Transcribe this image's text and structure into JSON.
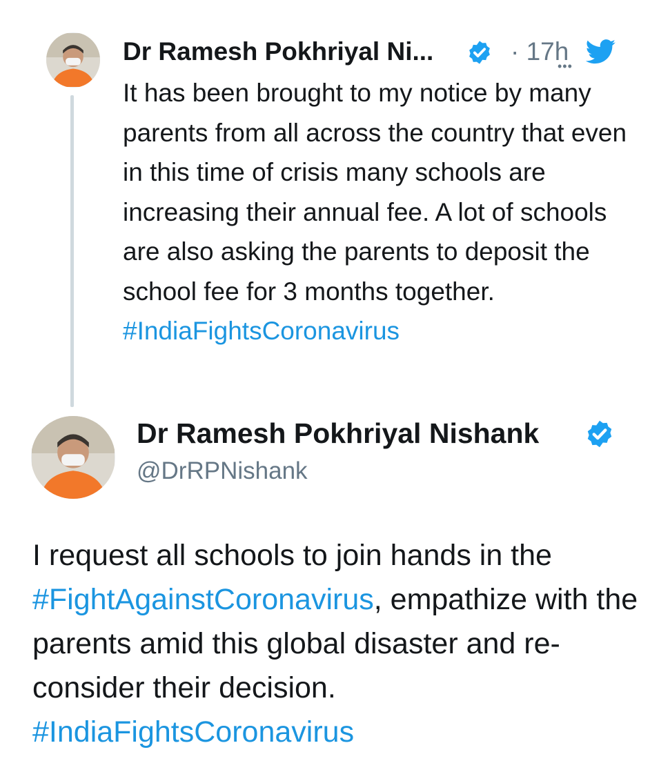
{
  "colors": {
    "link": "#1b95e0",
    "verified": "#1da1f2",
    "text": "#14171a",
    "secondary": "#657786",
    "thread_line": "#cfd9de"
  },
  "parent_tweet": {
    "author_name": "Dr Ramesh Pokhriyal Ni...",
    "timestamp": "· 17h",
    "text": "It has been brought to my notice by many parents from all across the country that even in this time of crisis many schools are increasing their annual fee. A lot of schools are also asking the parents to deposit the school fee for 3 months together.",
    "hashtag": "#IndiaFightsCoronavirus",
    "icons": [
      "avatar",
      "verified-badge-icon",
      "more-options-icon",
      "twitter-bird-icon"
    ]
  },
  "main_tweet": {
    "author_name": "Dr Ramesh Pokhriyal Nishank",
    "handle": "@DrRPNishank",
    "text_before": "I request all schools to join hands in the ",
    "hashtag_inline": "#FightAgainstCoronavirus",
    "text_after": ", empathize with the parents amid this global disaster and re-consider their decision.",
    "hashtag_end": "#IndiaFightsCoronavirus",
    "icons": [
      "avatar",
      "verified-badge-icon"
    ]
  }
}
